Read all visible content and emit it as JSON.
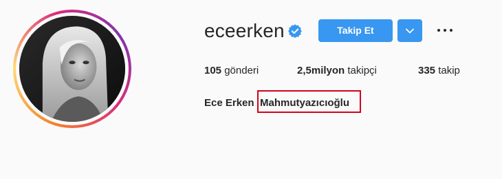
{
  "profile": {
    "username": "eceerken",
    "verified": true,
    "follow_label": "Takip Et",
    "full_name_first": "Ece Erken",
    "full_name_surname": "Mahmutyazıcıoğlu"
  },
  "stats": {
    "posts_count": "105",
    "posts_label": "gönderi",
    "followers_count": "2,5milyon",
    "followers_label": "takipçi",
    "following_count": "335",
    "following_label": "takip"
  },
  "icons": {
    "verified": "verified-badge-icon",
    "dropdown": "chevron-down-icon",
    "more": "more-options-icon"
  },
  "colors": {
    "accent": "#3897f0",
    "highlight_box": "#d0021b",
    "text": "#262626",
    "background": "#fafafa"
  }
}
